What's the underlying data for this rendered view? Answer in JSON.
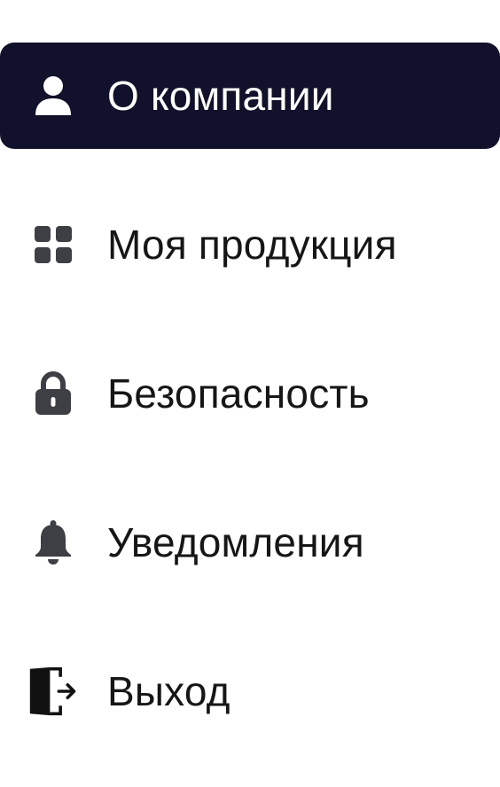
{
  "menu": {
    "items": [
      {
        "label": "О компании",
        "icon": "user-icon",
        "active": true
      },
      {
        "label": "Моя продукция",
        "icon": "grid-icon",
        "active": false
      },
      {
        "label": "Безопасность",
        "icon": "lock-icon",
        "active": false
      },
      {
        "label": "Уведомления",
        "icon": "bell-icon",
        "active": false
      },
      {
        "label": "Выход",
        "icon": "logout-icon",
        "active": false
      }
    ]
  },
  "colors": {
    "active_bg": "#11112b",
    "active_text": "#ffffff",
    "text": "#161616",
    "icon": "#3d3f45"
  }
}
